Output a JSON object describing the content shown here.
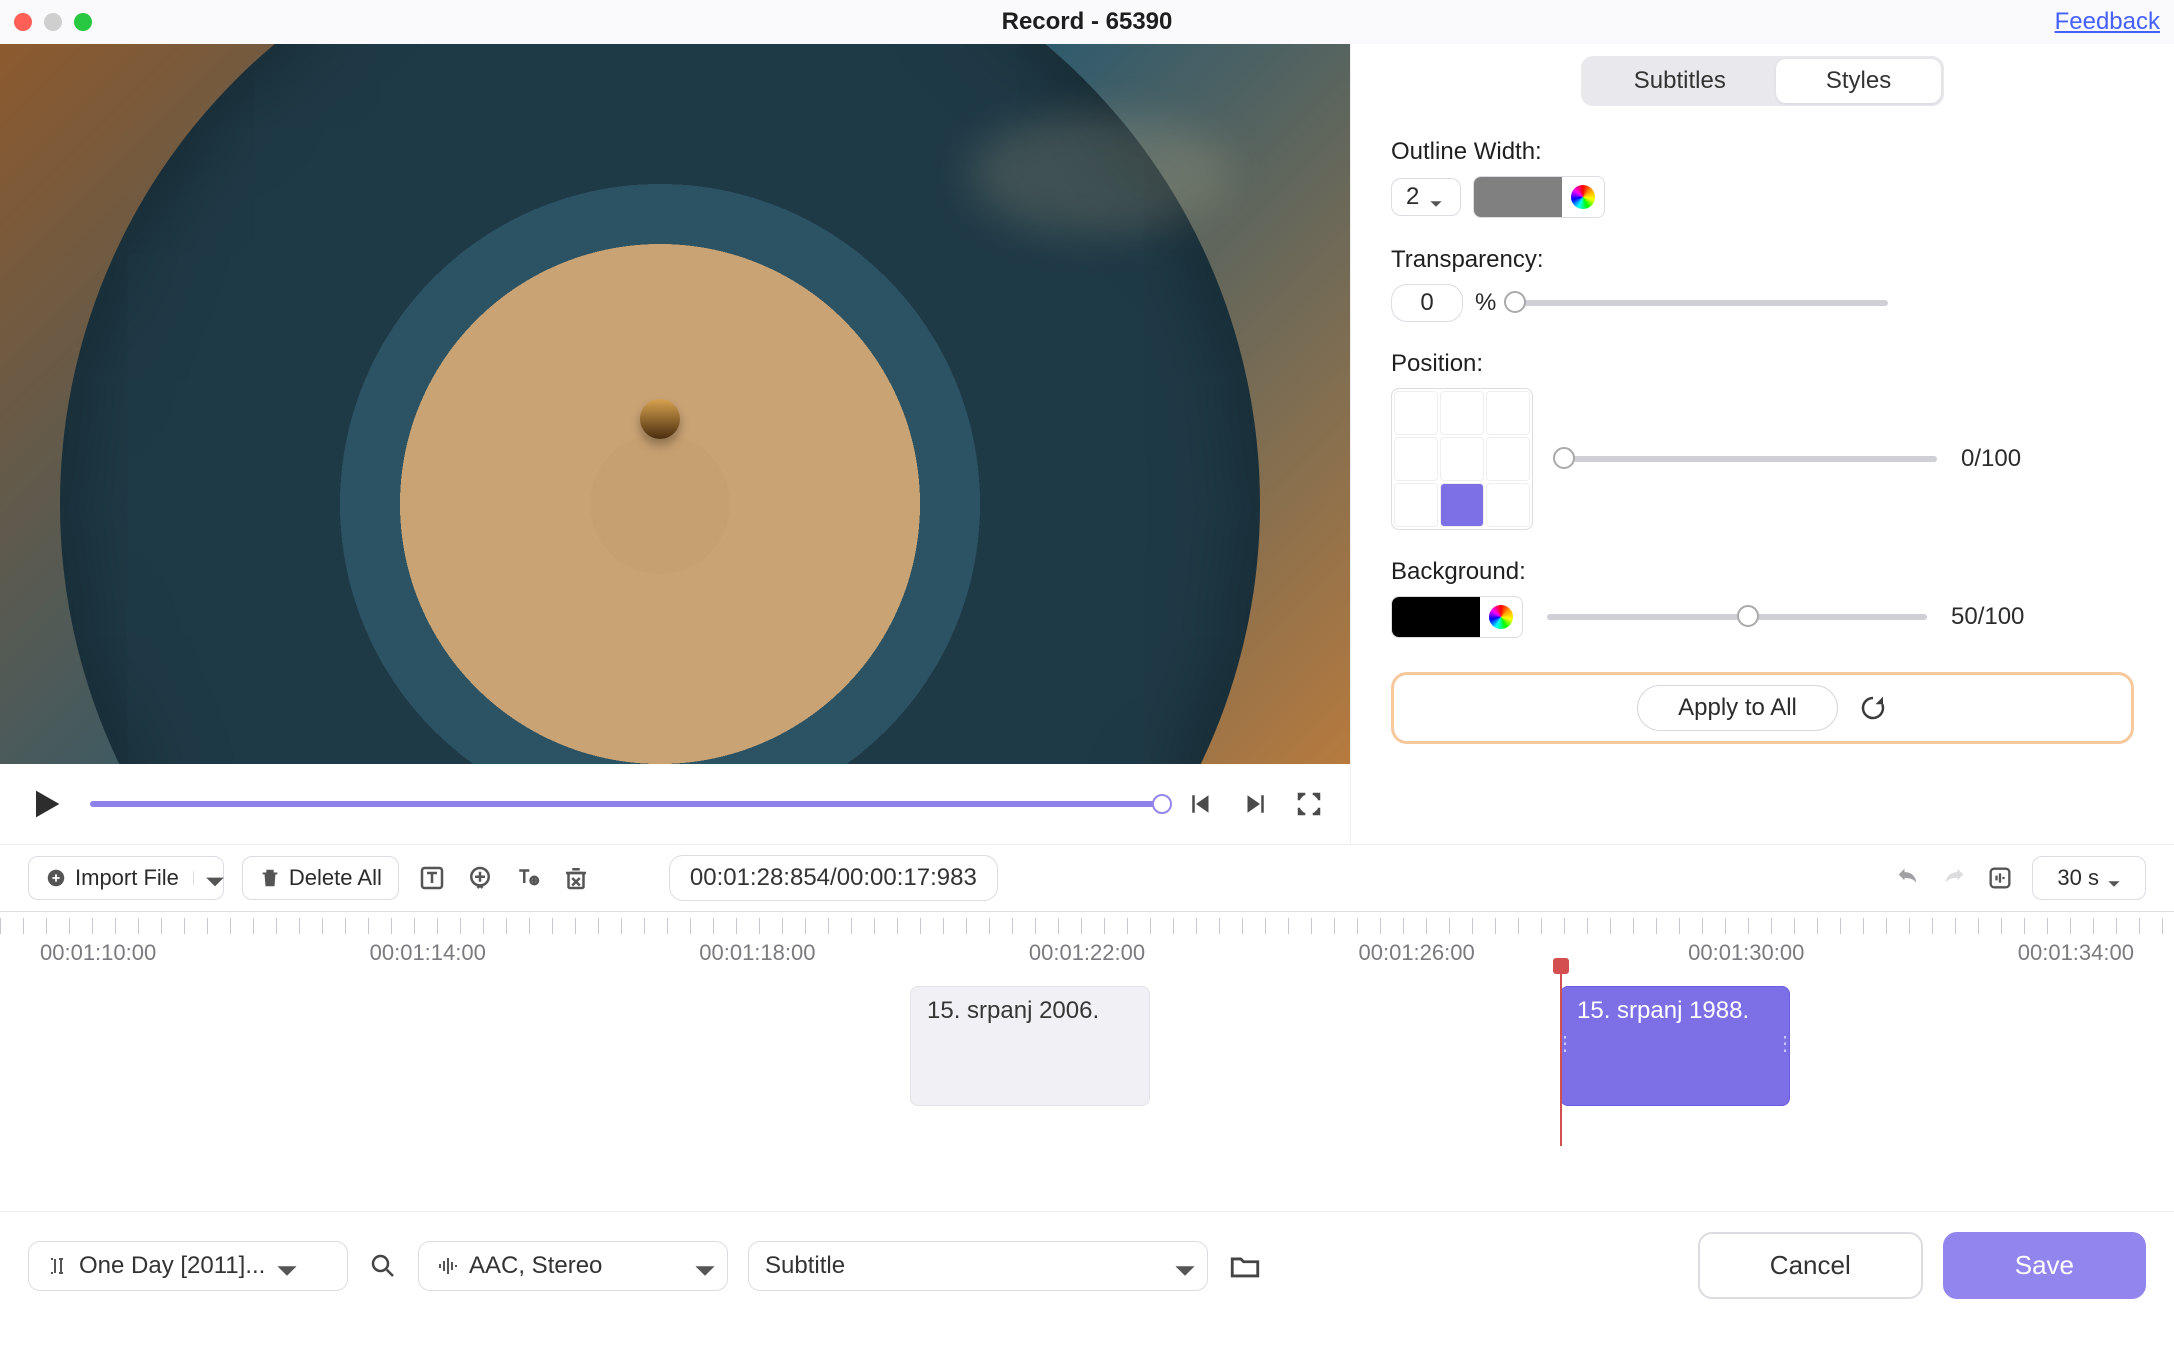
{
  "titlebar": {
    "title": "Record - 65390",
    "feedback": "Feedback"
  },
  "side": {
    "tabs": {
      "subtitles": "Subtitles",
      "styles": "Styles"
    },
    "outline_width_label": "Outline Width:",
    "outline_width_value": "2",
    "outline_color": "#808080",
    "transparency_label": "Transparency:",
    "transparency_value": "0",
    "percent": "%",
    "position_label": "Position:",
    "position_value": "0/100",
    "background_label": "Background:",
    "background_value": "50/100",
    "background_color": "#000000",
    "apply_to_all": "Apply to All"
  },
  "transport": {
    "total_time": "00:00:17:983",
    "current_time": "00:01:28:854"
  },
  "toolbar": {
    "import_file": "Import File",
    "delete_all": "Delete All",
    "timecode_sep": "/",
    "zoom_level": "30 s"
  },
  "timeline": {
    "ticks": [
      "00:01:10:00",
      "00:01:14:00",
      "00:01:18:00",
      "00:01:22:00",
      "00:01:26:00",
      "00:01:30:00",
      "00:01:34:00"
    ],
    "clip1": "15. srpanj 2006.",
    "clip2": "15. srpanj 1988."
  },
  "bottom": {
    "source_file": "One Day [2011]...",
    "audio": "AAC, Stereo",
    "track_type": "Subtitle",
    "cancel": "Cancel",
    "save": "Save"
  }
}
